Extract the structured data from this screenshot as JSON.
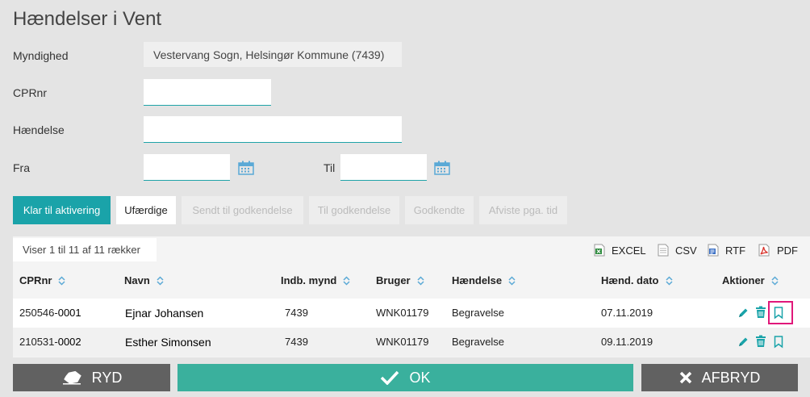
{
  "title": "Hændelser i Vent",
  "form": {
    "myndighed_label": "Myndighed",
    "myndighed_value": "Vestervang Sogn, Helsingør Kommune (7439)",
    "cprnr_label": "CPRnr",
    "cprnr_value": "",
    "haendelse_label": "Hændelse",
    "haendelse_value": "",
    "fra_label": "Fra",
    "fra_value": "",
    "til_label": "Til",
    "til_value": ""
  },
  "tabs": [
    {
      "label": "Klar til aktivering",
      "state": "active"
    },
    {
      "label": "Ufærdige",
      "state": "normal"
    },
    {
      "label": "Sendt til godkendelse",
      "state": "disabled"
    },
    {
      "label": "Til godkendelse",
      "state": "disabled"
    },
    {
      "label": "Godkendte",
      "state": "disabled"
    },
    {
      "label": "Afviste pga. tid",
      "state": "disabled"
    }
  ],
  "table": {
    "row_count_text": "Viser 1 til 11 af 11 rækker",
    "exports": [
      "EXCEL",
      "CSV",
      "RTF",
      "PDF"
    ],
    "columns": [
      "CPRnr",
      "Navn",
      "Indb. mynd",
      "Bruger",
      "Hændelse",
      "Hænd. dato",
      "Aktioner"
    ],
    "rows": [
      {
        "cpr_prefix": "250546-",
        "cpr_suffix": "0001",
        "navn": "Ejnar Johansen",
        "mynd": "7439",
        "bruger": "WNK01179",
        "haendelse": "Begravelse",
        "dato": "07.11.2019"
      },
      {
        "cpr_prefix": "210531-",
        "cpr_suffix": "0002",
        "navn": "Esther Simonsen",
        "mynd": "7439",
        "bruger": "WNK01179",
        "haendelse": "Begravelse",
        "dato": "09.11.2019"
      }
    ]
  },
  "footer": {
    "ryd": "RYD",
    "ok": "OK",
    "afbryd": "AFBRYD"
  },
  "colors": {
    "accent": "#1aa3a9",
    "ok_button": "#3ab09d",
    "dark_button": "#616161",
    "highlight": "#e0187a"
  }
}
